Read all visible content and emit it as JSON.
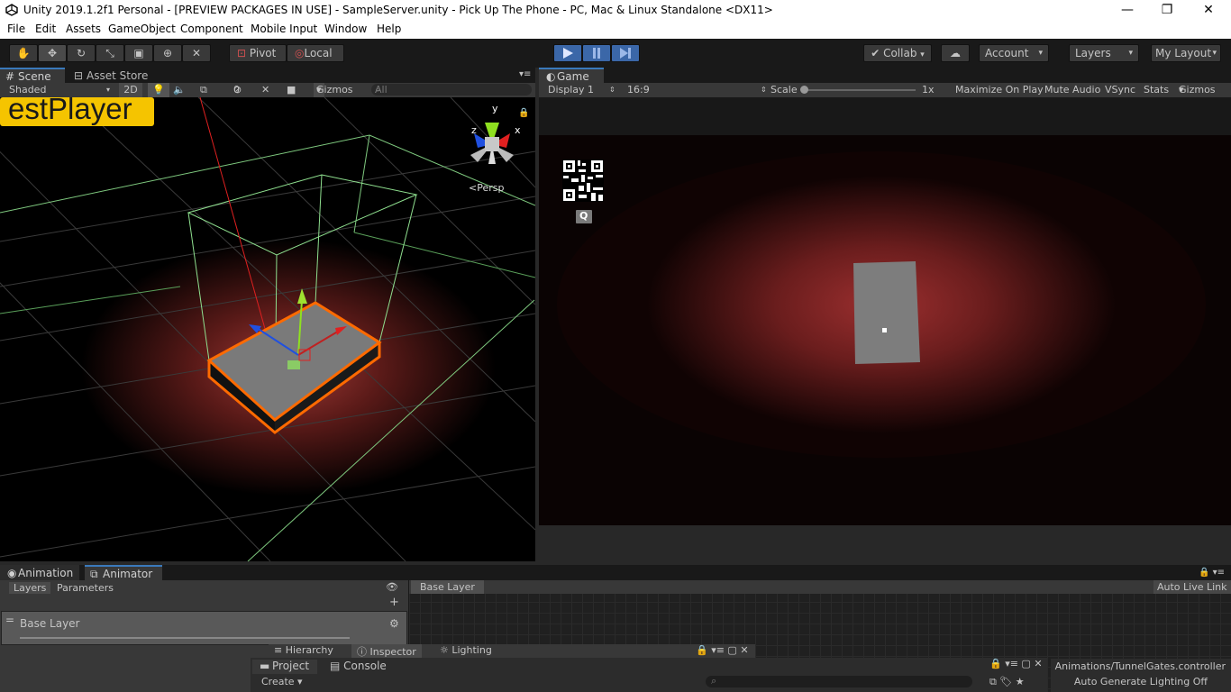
{
  "window": {
    "title": "Unity 2019.1.2f1 Personal - [PREVIEW PACKAGES IN USE] - SampleServer.unity - Pick Up The Phone - PC, Mac & Linux Standalone <DX11>",
    "minimize": "—",
    "maximize": "❐",
    "close": "✕"
  },
  "menu": [
    "File",
    "Edit",
    "Assets",
    "GameObject",
    "Component",
    "Mobile Input",
    "Window",
    "Help"
  ],
  "toolbar": {
    "pivot": "Pivot",
    "local": "Local",
    "collab": "Collab",
    "account": "Account",
    "layers": "Layers",
    "layout": "My Layout"
  },
  "scene": {
    "tab_scene": "Scene",
    "tab_asset_store": "Asset Store",
    "shading": "Shaded",
    "mode_2d": "2D",
    "hidden_count": "0",
    "gizmos": "Gizmos",
    "search_placeholder": "All",
    "overlay_text": "estPlayer",
    "persp": "Persp",
    "axis_x": "x",
    "axis_y": "y",
    "axis_z": "z"
  },
  "game": {
    "tab": "Game",
    "display": "Display 1",
    "aspect": "16:9",
    "scale_label": "Scale",
    "scale_value": "1x",
    "maximize_on_play": "Maximize On Play",
    "mute_audio": "Mute Audio",
    "vsync": "VSync",
    "stats": "Stats",
    "gizmos": "Gizmos",
    "qr_label": "Q"
  },
  "animator": {
    "tab_animation": "Animation",
    "tab_animator": "Animator",
    "layers_tab": "Layers",
    "parameters_tab": "Parameters",
    "base_layer_breadcrumb": "Base Layer",
    "auto_live_link": "Auto Live Link",
    "layer_name": "Base Layer",
    "controller_path": "Animations/TunnelGates.controller"
  },
  "bottom": {
    "tab_hierarchy": "Hierarchy",
    "tab_inspector": "Inspector",
    "tab_lighting": "Lighting",
    "tab_project": "Project",
    "tab_console": "Console",
    "create": "Create",
    "status": "Auto Generate Lighting Off"
  },
  "colors": {
    "play_blue": "#3b67a8",
    "selection_orange": "#ff6a00",
    "overlay_yellow": "#f5c400"
  }
}
